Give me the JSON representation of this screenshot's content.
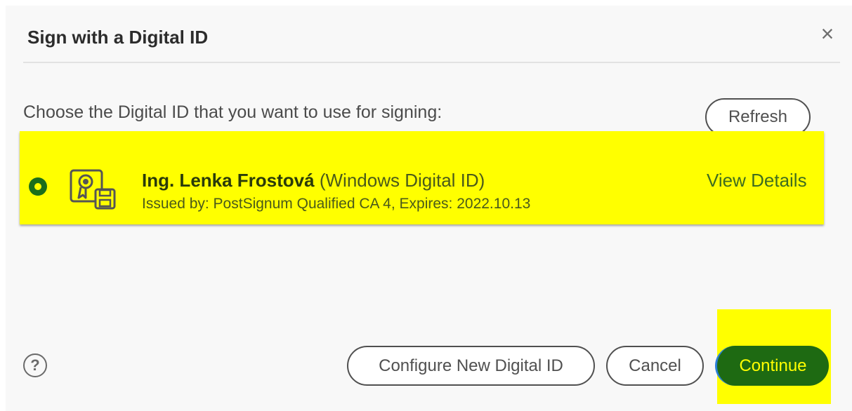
{
  "dialog": {
    "title": "Sign with a Digital ID",
    "close_icon": "close-icon"
  },
  "prompt": "Choose the Digital ID that you want to use for signing:",
  "refresh_label": "Refresh",
  "digital_id": {
    "selected": true,
    "icon": "certificate-icon",
    "name": "Ing. Lenka Frostová",
    "type": "(Windows Digital ID)",
    "issued_line": "Issued by: PostSignum Qualified CA 4, Expires: 2022.10.13",
    "view_details_label": "View Details",
    "highlight_color": "#ffff00"
  },
  "footer": {
    "help_icon": "help-icon",
    "help_symbol": "?",
    "configure_label": "Configure New Digital ID",
    "cancel_label": "Cancel",
    "continue_label": "Continue",
    "continue_color": "#1e6a12"
  }
}
